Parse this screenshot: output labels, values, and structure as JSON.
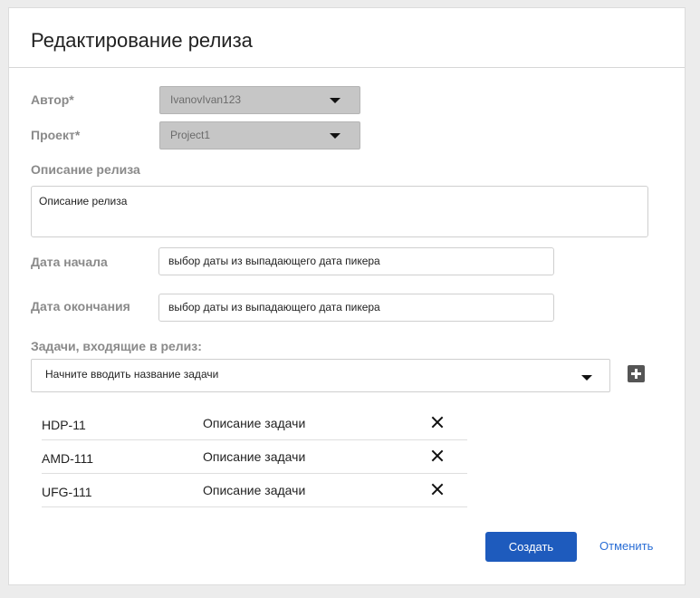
{
  "dialog": {
    "title": "Редактирование релиза"
  },
  "form": {
    "author": {
      "label": "Автор*",
      "value": "IvanovIvan123"
    },
    "project": {
      "label": "Проект*",
      "value": "Project1"
    },
    "description": {
      "label": "Описание релиза",
      "value": "Описание релиза"
    },
    "start_date": {
      "label": "Дата начала",
      "value": "выбор даты из выпадающего дата пикера"
    },
    "end_date": {
      "label": "Дата окончания",
      "value": "выбор даты из выпадающего дата пикера"
    },
    "tasks": {
      "label": "Задачи, входящие в релиз:",
      "placeholder": "Начните вводить название задачи",
      "items": [
        {
          "id": "HDP-11",
          "description": "Описание задачи"
        },
        {
          "id": "AMD-111",
          "description": "Описание задачи"
        },
        {
          "id": "UFG-111",
          "description": "Описание задачи"
        }
      ]
    }
  },
  "actions": {
    "create_label": "Создать",
    "cancel_label": "Отменить"
  },
  "icons": {
    "dropdown": "caret-down-icon",
    "add": "plus-icon",
    "remove": "close-icon"
  },
  "colors": {
    "primary": "#1e5bbd",
    "link": "#2a6ed6",
    "label": "#8a8a8a",
    "disabled_select": "#c6c6c6"
  }
}
